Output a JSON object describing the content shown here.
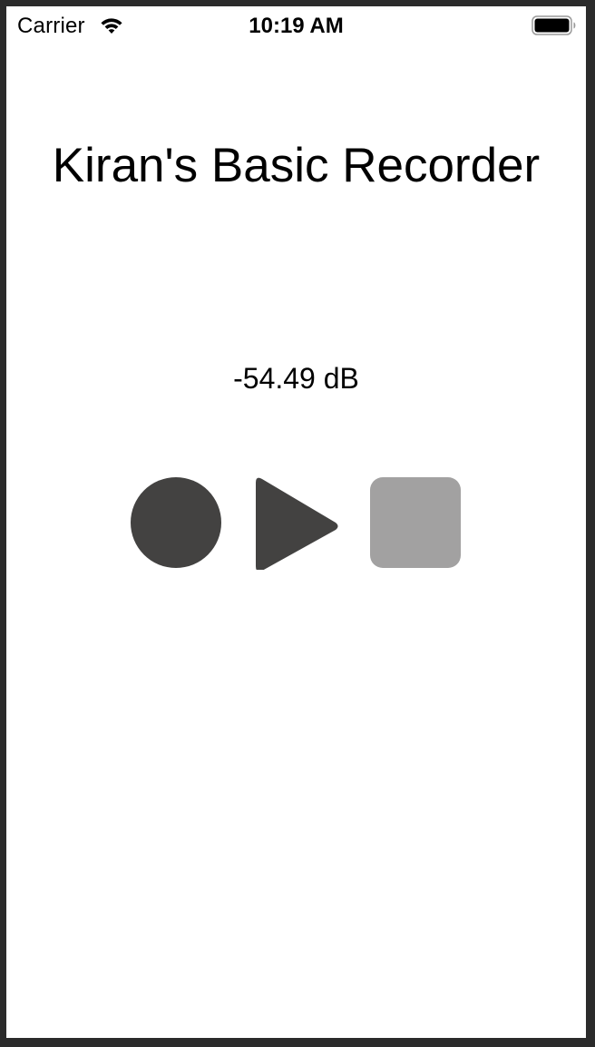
{
  "status_bar": {
    "carrier": "Carrier",
    "time": "10:19 AM",
    "wifi_icon": "wifi-icon",
    "battery_icon": "battery-full-icon"
  },
  "app": {
    "title": "Kiran's Basic Recorder",
    "level": "-54.49 dB"
  },
  "controls": {
    "record_icon": "record-circle-icon",
    "play_icon": "play-triangle-icon",
    "stop_icon": "stop-square-icon"
  },
  "colors": {
    "active_control": "#434241",
    "disabled_control": "#a2a1a1",
    "background": "#ffffff",
    "text": "#000000"
  }
}
